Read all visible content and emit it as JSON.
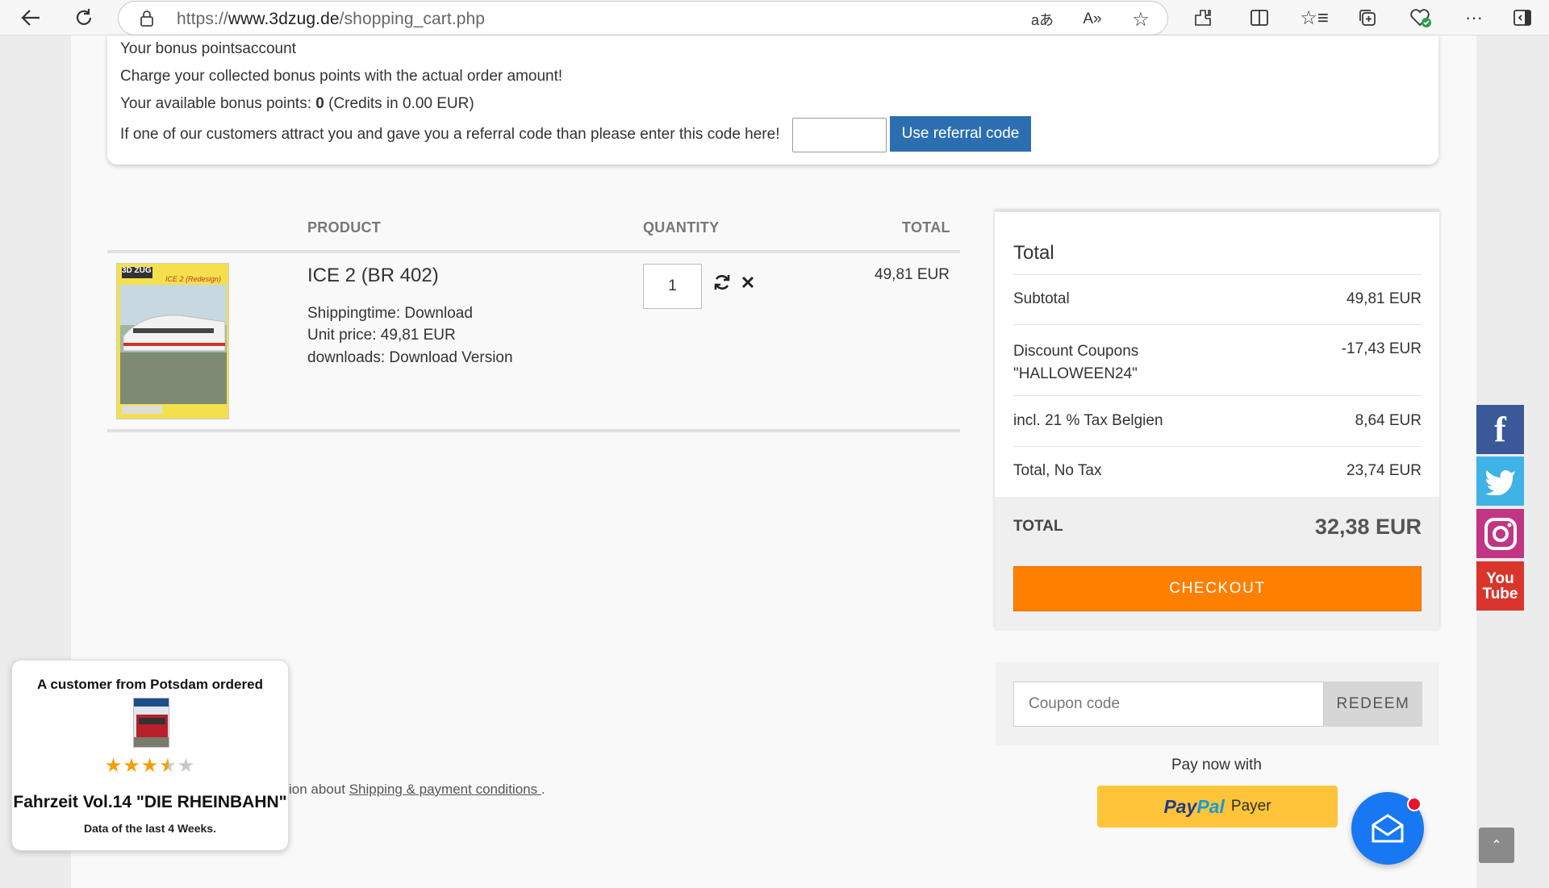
{
  "browser": {
    "url_prefix": "https://",
    "url_domain": "www.3dzug.de",
    "url_path": "/shopping_cart.php",
    "icons": [
      "back-icon",
      "refresh-icon",
      "lock-icon",
      "translate-icon",
      "read-aloud-icon",
      "favorite-icon",
      "extensions-icon",
      "split-screen-icon",
      "favorites-bar-icon",
      "collections-icon",
      "browser-essentials-icon",
      "more-icon",
      "sidebar-icon"
    ]
  },
  "bonus": {
    "heading": "Your bonus pointsaccount",
    "charge_text": "Charge your collected bonus points with the actual order amount!",
    "available_label": "Your available bonus points:",
    "available_value": "0",
    "available_credits": "(Credits in 0.00 EUR)",
    "referral_text": "If one of our customers attract you and gave you a referral code than please enter this code here!",
    "referral_value": "",
    "referral_button": "Use referral code"
  },
  "cart": {
    "headers": {
      "product": "PRODUCT",
      "quantity": "QUANTITY",
      "total": "TOTAL"
    },
    "item": {
      "title": "ICE 2 (BR 402)",
      "shipping": "Shippingtime: Download",
      "unit_price": "Unit price: 49,81 EUR",
      "downloads": "downloads: Download Version",
      "quantity": "1",
      "total": "49,81 EUR",
      "image_brand": "3D ZUG",
      "image_label": "ICE 2 (Redesign)"
    }
  },
  "totals": {
    "heading": "Total",
    "subtotal_label": "Subtotal",
    "subtotal_value": "49,81 EUR",
    "discount_label_1": "Discount Coupons",
    "discount_label_2": "\"HALLOWEEN24\"",
    "discount_value": "-17,43 EUR",
    "tax_label": "incl. 21 % Tax Belgien",
    "tax_value": "8,64 EUR",
    "notax_label": "Total, No Tax",
    "notax_value": "23,74 EUR",
    "grand_label": "TOTAL",
    "grand_value": "32,38 EUR",
    "checkout": "CHECKOUT"
  },
  "coupon": {
    "placeholder": "Coupon code",
    "button": "REDEEM"
  },
  "payment": {
    "paynow": "Pay now with",
    "paypal_pay": "Pay",
    "paypal_pal": "Pal",
    "paypal_payer": "Payer"
  },
  "shipping_note": {
    "prefix": "ion about ",
    "link": "Shipping & payment conditions ",
    "suffix": "."
  },
  "notification": {
    "title": "A customer from Potsdam ordered",
    "rating": 3.5,
    "product": "Fahrzeit Vol.14 \"DIE RHEINBAHN\"",
    "sub": "Data of the last 4 Weeks."
  },
  "social": [
    "facebook-icon",
    "twitter-icon",
    "instagram-icon",
    "youtube-icon"
  ],
  "colors": {
    "checkout": "#ff7f00",
    "referral_btn": "#2c6fb0",
    "paypal": "#ffc439",
    "chat": "#1877f2"
  }
}
